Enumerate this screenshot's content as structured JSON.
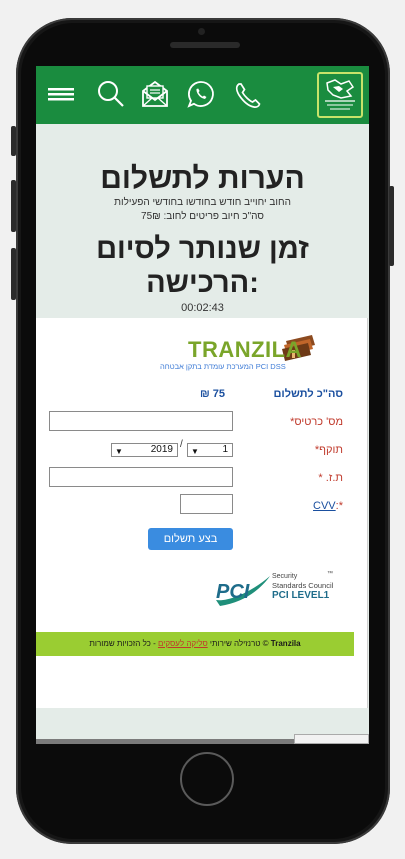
{
  "header": {
    "icons": [
      "menu-icon",
      "search-icon",
      "email-icon",
      "whatsapp-icon",
      "phone-icon"
    ],
    "logo": "municipal-logo-icon"
  },
  "page": {
    "title": "הערות לתשלום",
    "subtitle_line1": "החוב יחוייב חודש בחודשו בחודשי הפעילות",
    "subtitle_line2": "סה\"כ חיוב פריטים לחוב: 75₪",
    "countdown_title_line1": "זמן שנותר לסיום",
    "countdown_title_line2": "הרכישה:",
    "timer": "00:02:43"
  },
  "payment": {
    "brand": "TRANZILA",
    "tagline": "המערכת עומדת בתקן אבטחה PCI DSS",
    "total_label": "סה\"כ לתשלום",
    "amount": "₪ 75",
    "card_number_label": "מס' כרטיס*",
    "expiry_label": "תוקף*",
    "expiry_year": "2019",
    "expiry_month": "1",
    "expiry_separator": "/",
    "id_label": "ת.ז. *",
    "cvv_label": "CVV",
    "cvv_prefix": "*:",
    "submit_label": "בצע תשלום"
  },
  "pci": {
    "logo_text": "PCI",
    "line1": "Security",
    "line2": "Standards Council",
    "line3": "PCI LEVEL1",
    "tm": "™"
  },
  "footer": {
    "brand": "Tranzila",
    "text_before": "© טרנזילה שירותי",
    "link": "סליקה לעסקים",
    "text_after": "- כל הזכויות שמורות"
  },
  "colors": {
    "header_green": "#1a8c3f",
    "footer_lime": "#9acd32",
    "button_blue": "#3a8ce0"
  }
}
